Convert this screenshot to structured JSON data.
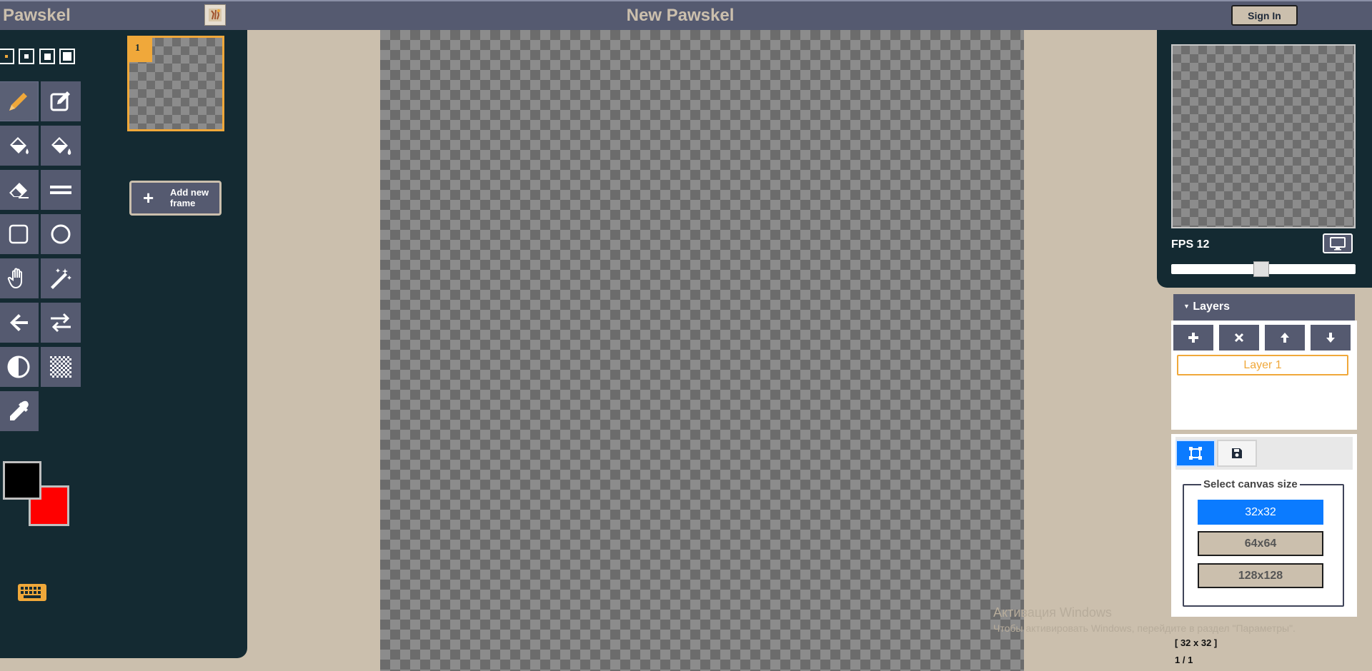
{
  "header": {
    "app_name": "Pawskel",
    "title": "New Pawskel",
    "sign_in": "Sign In",
    "logo_icon": "pawskel-logo-icon"
  },
  "pen_sizes": {
    "options": [
      1,
      2,
      3,
      4
    ],
    "selected": 1
  },
  "tools": [
    {
      "name": "pencil-icon",
      "active": true
    },
    {
      "name": "edit-pencil-icon",
      "active": false
    },
    {
      "name": "paint-bucket-icon",
      "active": false
    },
    {
      "name": "paint-bucket-drop-icon",
      "active": false
    },
    {
      "name": "eraser-icon",
      "active": false
    },
    {
      "name": "line-icon",
      "active": false
    },
    {
      "name": "rectangle-icon",
      "active": false
    },
    {
      "name": "circle-icon",
      "active": false
    },
    {
      "name": "hand-icon",
      "active": false
    },
    {
      "name": "magic-wand-icon",
      "active": false
    },
    {
      "name": "arrow-left-icon",
      "active": false
    },
    {
      "name": "swap-arrows-icon",
      "active": false
    },
    {
      "name": "contrast-icon",
      "active": false
    },
    {
      "name": "checkerboard-icon",
      "active": false
    },
    {
      "name": "eyedropper-icon",
      "active": false
    }
  ],
  "colors": {
    "primary": "#000000",
    "secondary": "#ff0000",
    "accent": "#f0a83a",
    "panel": "#142a32",
    "toolbar": "#555a70",
    "background": "#cbbfad"
  },
  "frames": {
    "items": [
      {
        "number": "1"
      }
    ],
    "add_label": "Add new frame"
  },
  "preview": {
    "fps_label": "FPS 12",
    "fps": 12,
    "monitor_icon": "monitor-icon"
  },
  "layers": {
    "header": "Layers",
    "buttons": [
      "plus-icon",
      "close-icon",
      "arrow-up-icon",
      "arrow-down-icon"
    ],
    "items": [
      {
        "label": "Layer 1",
        "selected": true
      }
    ]
  },
  "settings": {
    "tabs": [
      "resize-icon",
      "save-icon"
    ],
    "legend": "Select canvas size",
    "sizes": [
      {
        "label": "32x32",
        "selected": true
      },
      {
        "label": "64x64",
        "selected": false
      },
      {
        "label": "128x128",
        "selected": false
      }
    ]
  },
  "status": {
    "canvas_size": "[ 32 x 32 ]",
    "page": "1 / 1"
  },
  "watermark": {
    "line1": "Активация Windows",
    "line2": "Чтобы активировать Windows, перейдите в раздел \"Параметры\"."
  }
}
